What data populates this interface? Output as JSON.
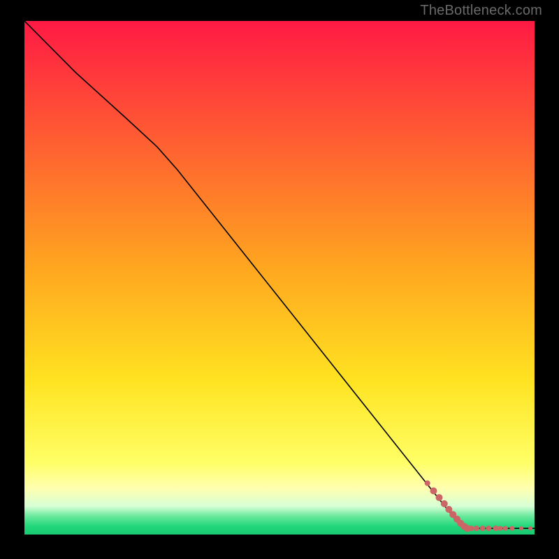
{
  "watermark": "TheBottleneck.com",
  "chart_data": {
    "type": "line",
    "title": "",
    "xlabel": "",
    "ylabel": "",
    "xlim": [
      0,
      100
    ],
    "ylim": [
      0,
      100
    ],
    "background_gradient": {
      "stops": [
        {
          "offset": 0.0,
          "color": "#ff1a44"
        },
        {
          "offset": 0.48,
          "color": "#ffa61f"
        },
        {
          "offset": 0.7,
          "color": "#ffe321"
        },
        {
          "offset": 0.86,
          "color": "#ffff66"
        },
        {
          "offset": 0.91,
          "color": "#ffffb0"
        },
        {
          "offset": 0.945,
          "color": "#d6ffd6"
        },
        {
          "offset": 0.965,
          "color": "#66e89a"
        },
        {
          "offset": 0.985,
          "color": "#1fd67a"
        },
        {
          "offset": 1.0,
          "color": "#19c972"
        }
      ]
    },
    "series": [
      {
        "name": "curve",
        "color": "#000000",
        "points": [
          {
            "x": 0.0,
            "y": 100.0
          },
          {
            "x": 10.0,
            "y": 90.0
          },
          {
            "x": 20.0,
            "y": 81.0
          },
          {
            "x": 26.0,
            "y": 75.5
          },
          {
            "x": 30.0,
            "y": 71.0
          },
          {
            "x": 40.0,
            "y": 58.5
          },
          {
            "x": 50.0,
            "y": 46.0
          },
          {
            "x": 60.0,
            "y": 33.5
          },
          {
            "x": 70.0,
            "y": 21.0
          },
          {
            "x": 80.0,
            "y": 8.5
          },
          {
            "x": 85.0,
            "y": 2.3
          },
          {
            "x": 86.8,
            "y": 1.2
          },
          {
            "x": 100.0,
            "y": 1.2
          }
        ]
      }
    ],
    "scatter": {
      "name": "markers",
      "color": "#cc6666",
      "points": [
        {
          "x": 79.0,
          "y": 10.0,
          "r": 4
        },
        {
          "x": 80.2,
          "y": 8.5,
          "r": 5
        },
        {
          "x": 81.3,
          "y": 7.2,
          "r": 5
        },
        {
          "x": 82.3,
          "y": 6.0,
          "r": 5
        },
        {
          "x": 83.2,
          "y": 4.9,
          "r": 5
        },
        {
          "x": 84.0,
          "y": 3.9,
          "r": 5
        },
        {
          "x": 84.8,
          "y": 3.0,
          "r": 5
        },
        {
          "x": 85.5,
          "y": 2.2,
          "r": 5
        },
        {
          "x": 86.2,
          "y": 1.6,
          "r": 5
        },
        {
          "x": 86.8,
          "y": 1.2,
          "r": 5
        },
        {
          "x": 87.6,
          "y": 1.2,
          "r": 4
        },
        {
          "x": 88.6,
          "y": 1.2,
          "r": 4
        },
        {
          "x": 89.8,
          "y": 1.2,
          "r": 4
        },
        {
          "x": 91.0,
          "y": 1.2,
          "r": 4
        },
        {
          "x": 92.4,
          "y": 1.2,
          "r": 4
        },
        {
          "x": 93.3,
          "y": 1.2,
          "r": 3.5
        },
        {
          "x": 94.3,
          "y": 1.2,
          "r": 3.5
        },
        {
          "x": 95.6,
          "y": 1.2,
          "r": 3.5
        },
        {
          "x": 97.4,
          "y": 1.2,
          "r": 3
        },
        {
          "x": 99.2,
          "y": 1.2,
          "r": 3
        }
      ]
    }
  }
}
